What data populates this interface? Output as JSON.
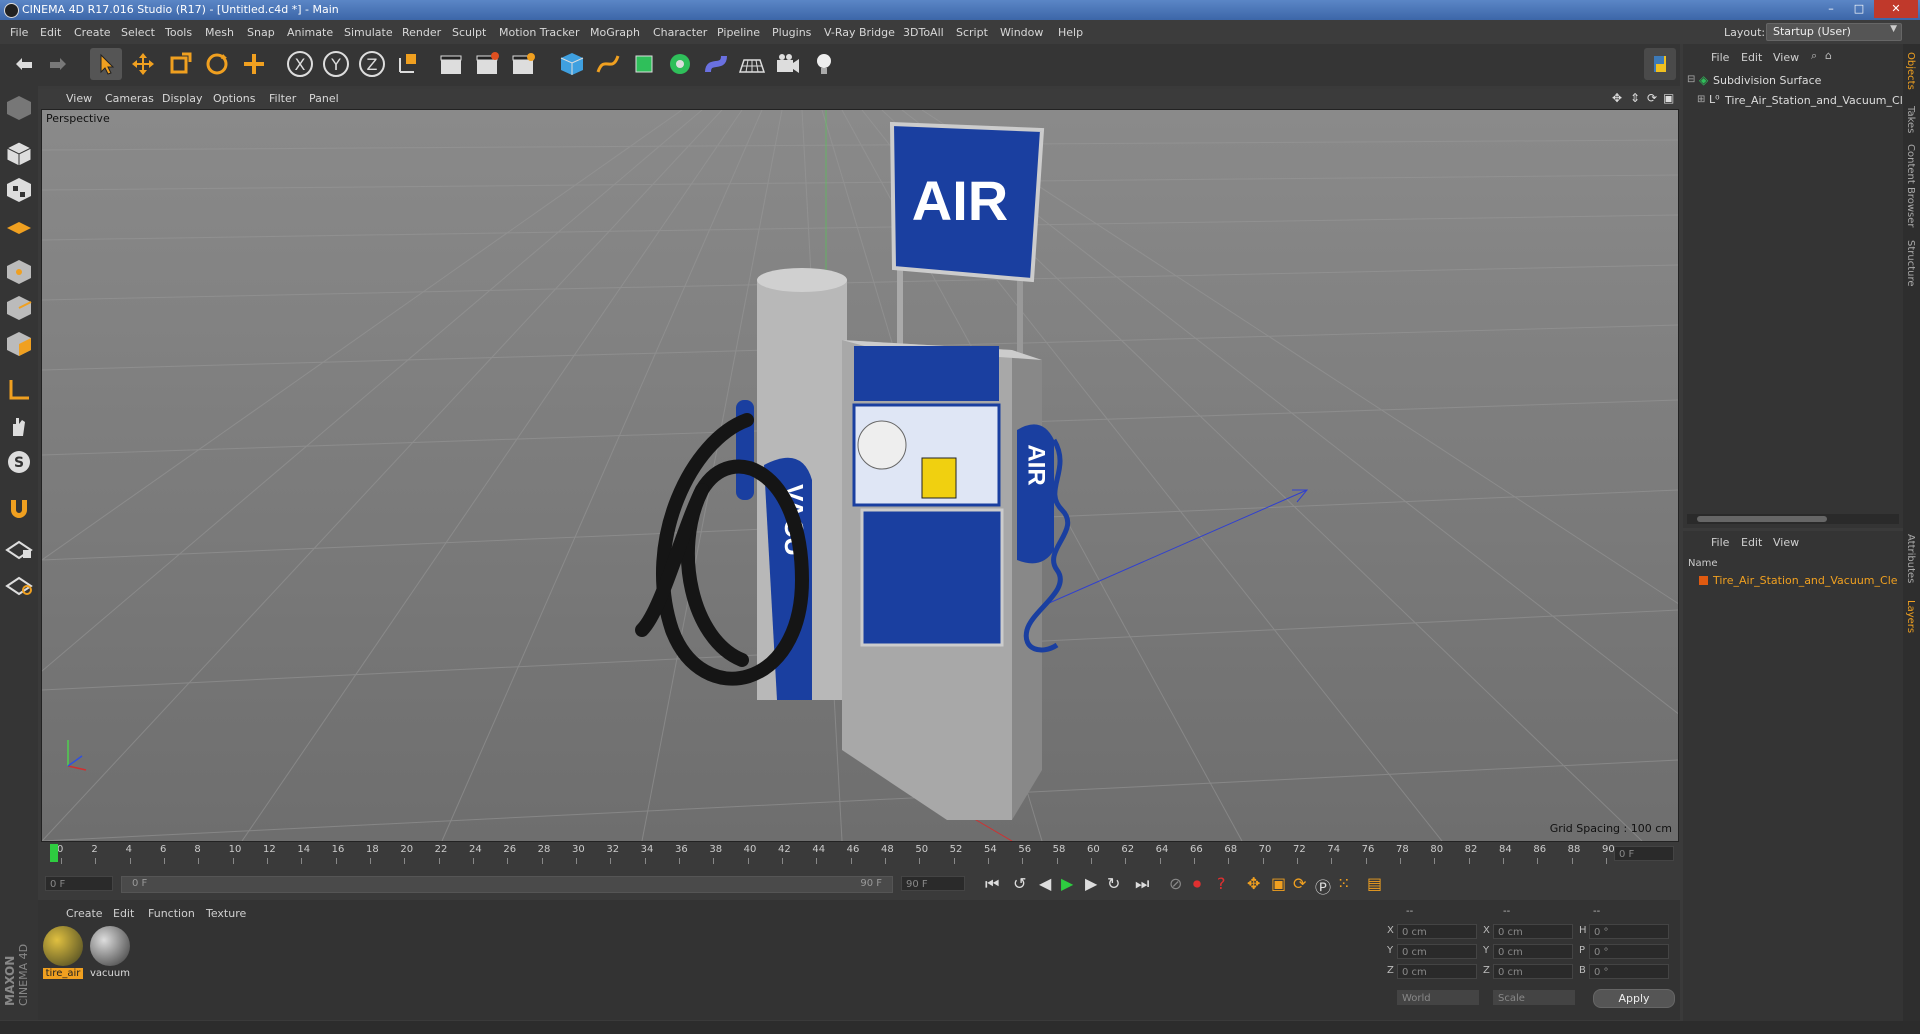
{
  "window": {
    "title": "CINEMA 4D R17.016 Studio (R17) - [Untitled.c4d *] - Main",
    "minimize": "–",
    "maximize": "□",
    "close": "✕"
  },
  "menubar": {
    "items": [
      "File",
      "Edit",
      "Create",
      "Select",
      "Tools",
      "Mesh",
      "Snap",
      "Animate",
      "Simulate",
      "Render",
      "Sculpt",
      "Motion Tracker",
      "MoGraph",
      "Character",
      "Pipeline",
      "Plugins",
      "V-Ray Bridge",
      "3DToAll",
      "Script",
      "Window",
      "Help"
    ],
    "layout_label": "Layout:",
    "layout_value": "Startup (User)"
  },
  "viewport": {
    "menu": [
      "View",
      "Cameras",
      "Display",
      "Options",
      "Filter",
      "Panel"
    ],
    "label": "Perspective",
    "grid_spacing": "Grid Spacing : 100 cm",
    "sign_text": "AIR",
    "hose_text": "AIR",
    "vacuum_text": "VACU"
  },
  "timeline": {
    "ticks": [
      "0",
      "2",
      "4",
      "6",
      "8",
      "10",
      "12",
      "14",
      "16",
      "18",
      "20",
      "22",
      "24",
      "26",
      "28",
      "30",
      "32",
      "34",
      "36",
      "38",
      "40",
      "42",
      "44",
      "46",
      "48",
      "50",
      "52",
      "54",
      "56",
      "58",
      "60",
      "62",
      "64",
      "66",
      "68",
      "70",
      "72",
      "74",
      "76",
      "78",
      "80",
      "82",
      "84",
      "86",
      "88",
      "90"
    ],
    "frame_display": "0 F"
  },
  "transport": {
    "start_field": "0 F",
    "range_start": "0 F",
    "range_end": "90 F",
    "end_field": "90 F"
  },
  "material_manager": {
    "menu": [
      "Create",
      "Edit",
      "Function",
      "Texture"
    ],
    "materials": [
      {
        "name": "tire_air",
        "selected": true
      },
      {
        "name": "vacuum",
        "selected": false
      }
    ]
  },
  "coordinates": {
    "header": [
      "--",
      "--",
      "--"
    ],
    "rows": [
      {
        "a_label": "X",
        "a_val": "0 cm",
        "b_label": "X",
        "b_val": "0 cm",
        "c_label": "H",
        "c_val": "0 °"
      },
      {
        "a_label": "Y",
        "a_val": "0 cm",
        "b_label": "Y",
        "b_val": "0 cm",
        "c_label": "P",
        "c_val": "0 °"
      },
      {
        "a_label": "Z",
        "a_val": "0 cm",
        "b_label": "Z",
        "b_val": "0 cm",
        "c_label": "B",
        "c_val": "0 °"
      }
    ],
    "space": "World",
    "mode": "Scale",
    "apply": "Apply"
  },
  "object_manager": {
    "menu": [
      "File",
      "Edit",
      "View"
    ],
    "objects": [
      {
        "name": "Subdivision Surface"
      },
      {
        "name": "Tire_Air_Station_and_Vacuum_Cl"
      }
    ]
  },
  "layer_manager": {
    "menu": [
      "File",
      "Edit",
      "View"
    ],
    "column": "Name",
    "layers": [
      {
        "name": "Tire_Air_Station_and_Vacuum_Cle"
      }
    ]
  },
  "side_tabs": [
    "Objects",
    "Takes",
    "Content Browser",
    "Structure",
    "Attributes",
    "Layers"
  ],
  "branding": {
    "vendor": "MAXON",
    "product": "CINEMA 4D"
  },
  "colors": {
    "accent": "#f0a020",
    "selection": "#ff6a00",
    "blue": "#1a3fa0"
  }
}
